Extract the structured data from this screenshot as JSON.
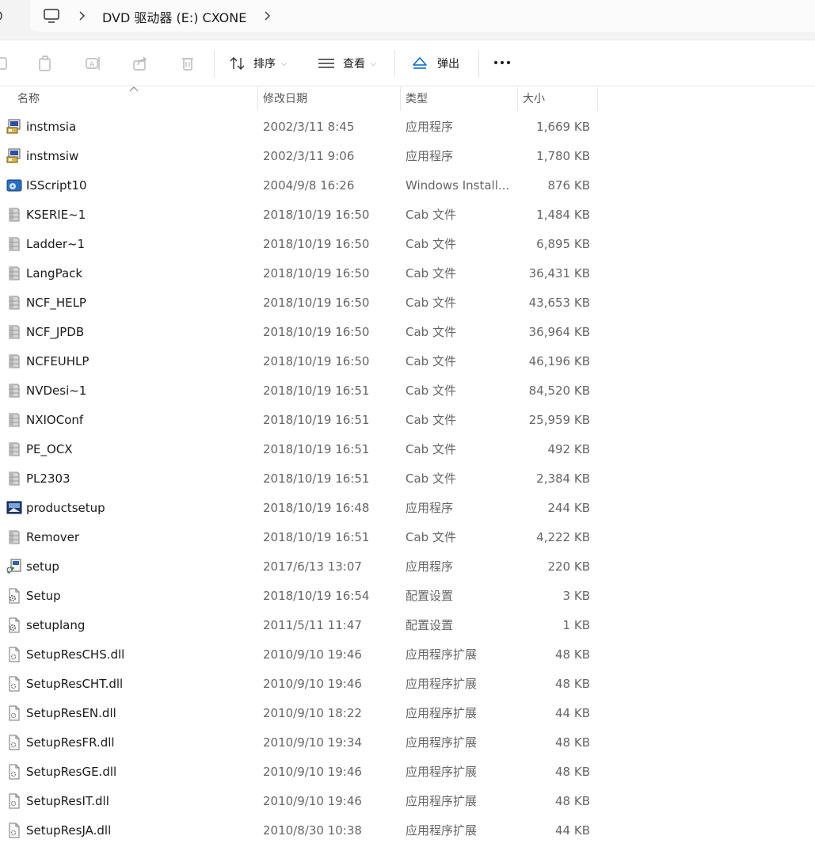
{
  "address": {
    "segments": [
      "DVD 驱动器 (E:) CXONE"
    ]
  },
  "toolbar": {
    "sort_label": "排序",
    "view_label": "查看",
    "eject_label": "弹出"
  },
  "columns": {
    "name": "名称",
    "date": "修改日期",
    "type": "类型",
    "size": "大小"
  },
  "files": [
    {
      "name": "instmsia",
      "date": "2002/3/11 8:45",
      "type": "应用程序",
      "size": "1,669 KB",
      "icon": "installer-exe-icon"
    },
    {
      "name": "instmsiw",
      "date": "2002/3/11 9:06",
      "type": "应用程序",
      "size": "1,780 KB",
      "icon": "installer-exe-icon"
    },
    {
      "name": "ISScript10",
      "date": "2004/9/8 16:26",
      "type": "Windows Install...",
      "size": "876 KB",
      "icon": "msi-package-icon"
    },
    {
      "name": "KSERIE~1",
      "date": "2018/10/19 16:50",
      "type": "Cab 文件",
      "size": "1,484 KB",
      "icon": "cab-file-icon"
    },
    {
      "name": "Ladder~1",
      "date": "2018/10/19 16:50",
      "type": "Cab 文件",
      "size": "6,895 KB",
      "icon": "cab-file-icon"
    },
    {
      "name": "LangPack",
      "date": "2018/10/19 16:50",
      "type": "Cab 文件",
      "size": "36,431 KB",
      "icon": "cab-file-icon"
    },
    {
      "name": "NCF_HELP",
      "date": "2018/10/19 16:50",
      "type": "Cab 文件",
      "size": "43,653 KB",
      "icon": "cab-file-icon"
    },
    {
      "name": "NCF_JPDB",
      "date": "2018/10/19 16:50",
      "type": "Cab 文件",
      "size": "36,964 KB",
      "icon": "cab-file-icon"
    },
    {
      "name": "NCFEUHLP",
      "date": "2018/10/19 16:50",
      "type": "Cab 文件",
      "size": "46,196 KB",
      "icon": "cab-file-icon"
    },
    {
      "name": "NVDesi~1",
      "date": "2018/10/19 16:51",
      "type": "Cab 文件",
      "size": "84,520 KB",
      "icon": "cab-file-icon"
    },
    {
      "name": "NXIOConf",
      "date": "2018/10/19 16:51",
      "type": "Cab 文件",
      "size": "25,959 KB",
      "icon": "cab-file-icon"
    },
    {
      "name": "PE_OCX",
      "date": "2018/10/19 16:51",
      "type": "Cab 文件",
      "size": "492 KB",
      "icon": "cab-file-icon"
    },
    {
      "name": "PL2303",
      "date": "2018/10/19 16:51",
      "type": "Cab 文件",
      "size": "2,384 KB",
      "icon": "cab-file-icon"
    },
    {
      "name": "productsetup",
      "date": "2018/10/19 16:48",
      "type": "应用程序",
      "size": "244 KB",
      "icon": "setup-exe-icon"
    },
    {
      "name": "Remover",
      "date": "2018/10/19 16:51",
      "type": "Cab 文件",
      "size": "4,222 KB",
      "icon": "cab-file-icon"
    },
    {
      "name": "setup",
      "date": "2017/6/13 13:07",
      "type": "应用程序",
      "size": "220 KB",
      "icon": "setup-wizard-icon"
    },
    {
      "name": "Setup",
      "date": "2018/10/19 16:54",
      "type": "配置设置",
      "size": "3 KB",
      "icon": "config-file-icon"
    },
    {
      "name": "setuplang",
      "date": "2011/5/11 11:47",
      "type": "配置设置",
      "size": "1 KB",
      "icon": "config-file-icon"
    },
    {
      "name": "SetupResCHS.dll",
      "date": "2010/9/10 19:46",
      "type": "应用程序扩展",
      "size": "48 KB",
      "icon": "dll-file-icon"
    },
    {
      "name": "SetupResCHT.dll",
      "date": "2010/9/10 19:46",
      "type": "应用程序扩展",
      "size": "48 KB",
      "icon": "dll-file-icon"
    },
    {
      "name": "SetupResEN.dll",
      "date": "2010/9/10 18:22",
      "type": "应用程序扩展",
      "size": "44 KB",
      "icon": "dll-file-icon"
    },
    {
      "name": "SetupResFR.dll",
      "date": "2010/9/10 19:34",
      "type": "应用程序扩展",
      "size": "48 KB",
      "icon": "dll-file-icon"
    },
    {
      "name": "SetupResGE.dll",
      "date": "2010/9/10 19:46",
      "type": "应用程序扩展",
      "size": "48 KB",
      "icon": "dll-file-icon"
    },
    {
      "name": "SetupResIT.dll",
      "date": "2010/9/10 19:46",
      "type": "应用程序扩展",
      "size": "48 KB",
      "icon": "dll-file-icon"
    },
    {
      "name": "SetupResJA.dll",
      "date": "2010/8/30 10:38",
      "type": "应用程序扩展",
      "size": "44 KB",
      "icon": "dll-file-icon"
    }
  ],
  "colors": {
    "accent": "#0067c0",
    "eject": "#0067c0",
    "text_secondary": "#666666"
  }
}
